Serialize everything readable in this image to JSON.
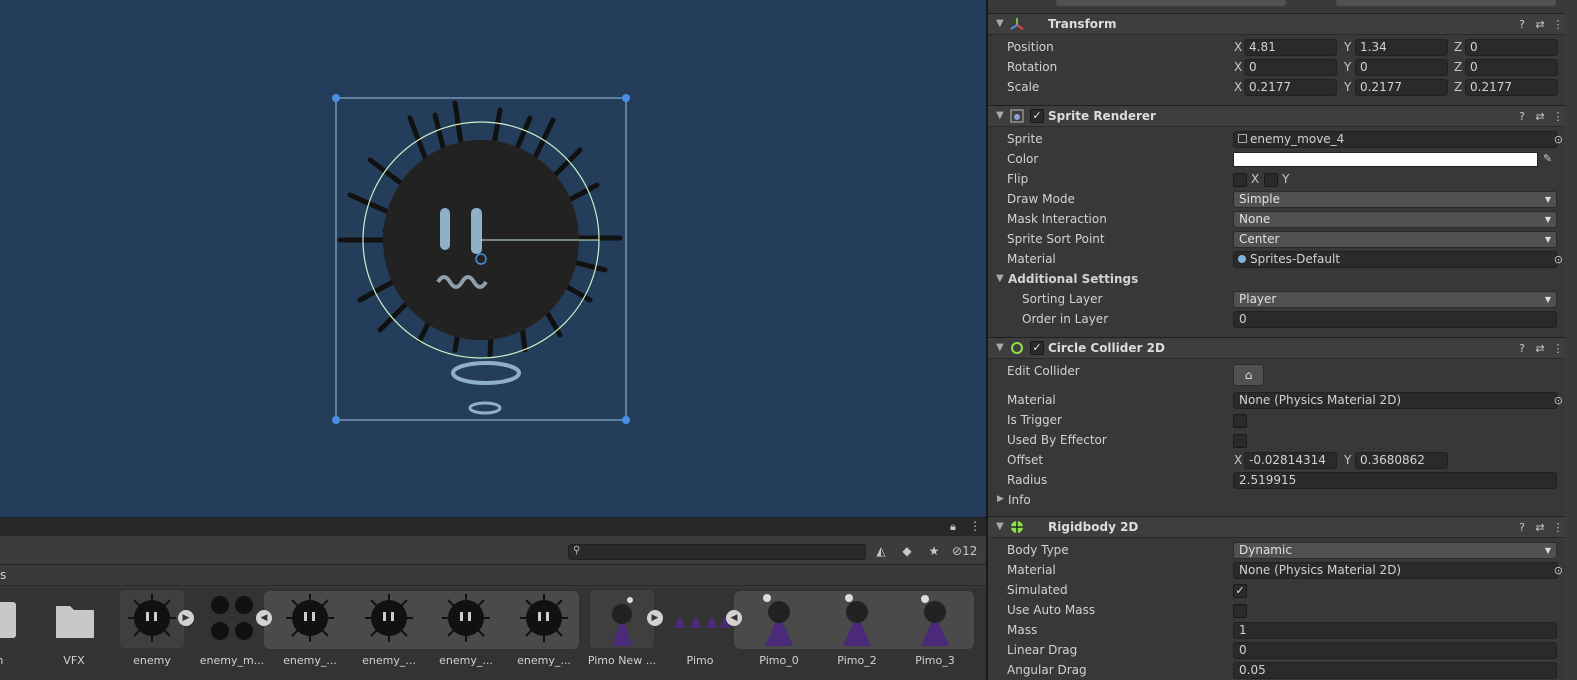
{
  "colors": {
    "scene_bg": "#243d5a",
    "selection_outline": "#9ec3e6",
    "collider_outline": "#c8f0c8",
    "handle": "#4a90e2",
    "panel_bg": "#383838"
  },
  "project": {
    "search_placeholder": "",
    "hidden_count": "12",
    "breadcrumb": "s",
    "assets": [
      {
        "name": "ain",
        "icon": "file-icon"
      },
      {
        "name": "VFX",
        "icon": "folder-icon"
      },
      {
        "name": "enemy",
        "icon": "enemy-sprite"
      },
      {
        "name": "enemy_m...",
        "icon": "enemy-sheet"
      },
      {
        "name": "enemy_...",
        "icon": "enemy-sprite"
      },
      {
        "name": "enemy_...",
        "icon": "enemy-sprite"
      },
      {
        "name": "enemy_...",
        "icon": "enemy-sprite"
      },
      {
        "name": "enemy_...",
        "icon": "enemy-sprite"
      },
      {
        "name": "Pimo New ...",
        "icon": "pimo-sprite"
      },
      {
        "name": "Pimo",
        "icon": "pimo-sheet"
      },
      {
        "name": "Pimo_0",
        "icon": "pimo-sprite"
      },
      {
        "name": "Pimo_2",
        "icon": "pimo-sprite"
      },
      {
        "name": "Pimo_3",
        "icon": "pimo-sprite"
      }
    ]
  },
  "inspector": {
    "transform": {
      "title": "Transform",
      "position": {
        "label": "Position",
        "x": "4.81",
        "y": "1.34",
        "z": "0"
      },
      "rotation": {
        "label": "Rotation",
        "x": "0",
        "y": "0",
        "z": "0"
      },
      "scale": {
        "label": "Scale",
        "x": "0.2177",
        "y": "0.2177",
        "z": "0.2177"
      }
    },
    "sprite_renderer": {
      "title": "Sprite Renderer",
      "sprite_label": "Sprite",
      "sprite": "enemy_move_4",
      "color_label": "Color",
      "flip_label": "Flip",
      "flip_x": "X",
      "flip_y": "Y",
      "draw_mode_label": "Draw Mode",
      "draw_mode": "Simple",
      "mask_label": "Mask Interaction",
      "mask": "None",
      "sort_point_label": "Sprite Sort Point",
      "sort_point": "Center",
      "material_label": "Material",
      "material": "Sprites-Default",
      "additional_label": "Additional Settings",
      "sorting_layer_label": "Sorting Layer",
      "sorting_layer": "Player",
      "order_label": "Order in Layer",
      "order": "0"
    },
    "circle_collider": {
      "title": "Circle Collider 2D",
      "edit_label": "Edit Collider",
      "material_label": "Material",
      "material": "None (Physics Material 2D)",
      "trigger_label": "Is Trigger",
      "effector_label": "Used By Effector",
      "offset_label": "Offset",
      "offset_x": "-0.02814314",
      "offset_y": "0.3680862",
      "radius_label": "Radius",
      "radius": "2.519915",
      "info_label": "Info"
    },
    "rigidbody": {
      "title": "Rigidbody 2D",
      "body_type_label": "Body Type",
      "body_type": "Dynamic",
      "material_label": "Material",
      "material": "None (Physics Material 2D)",
      "simulated_label": "Simulated",
      "auto_mass_label": "Use Auto Mass",
      "mass_label": "Mass",
      "mass": "1",
      "linear_drag_label": "Linear Drag",
      "linear_drag": "0",
      "angular_drag_label": "Angular Drag",
      "angular_drag": "0.05"
    },
    "axis": {
      "x": "X",
      "y": "Y",
      "z": "Z"
    }
  }
}
